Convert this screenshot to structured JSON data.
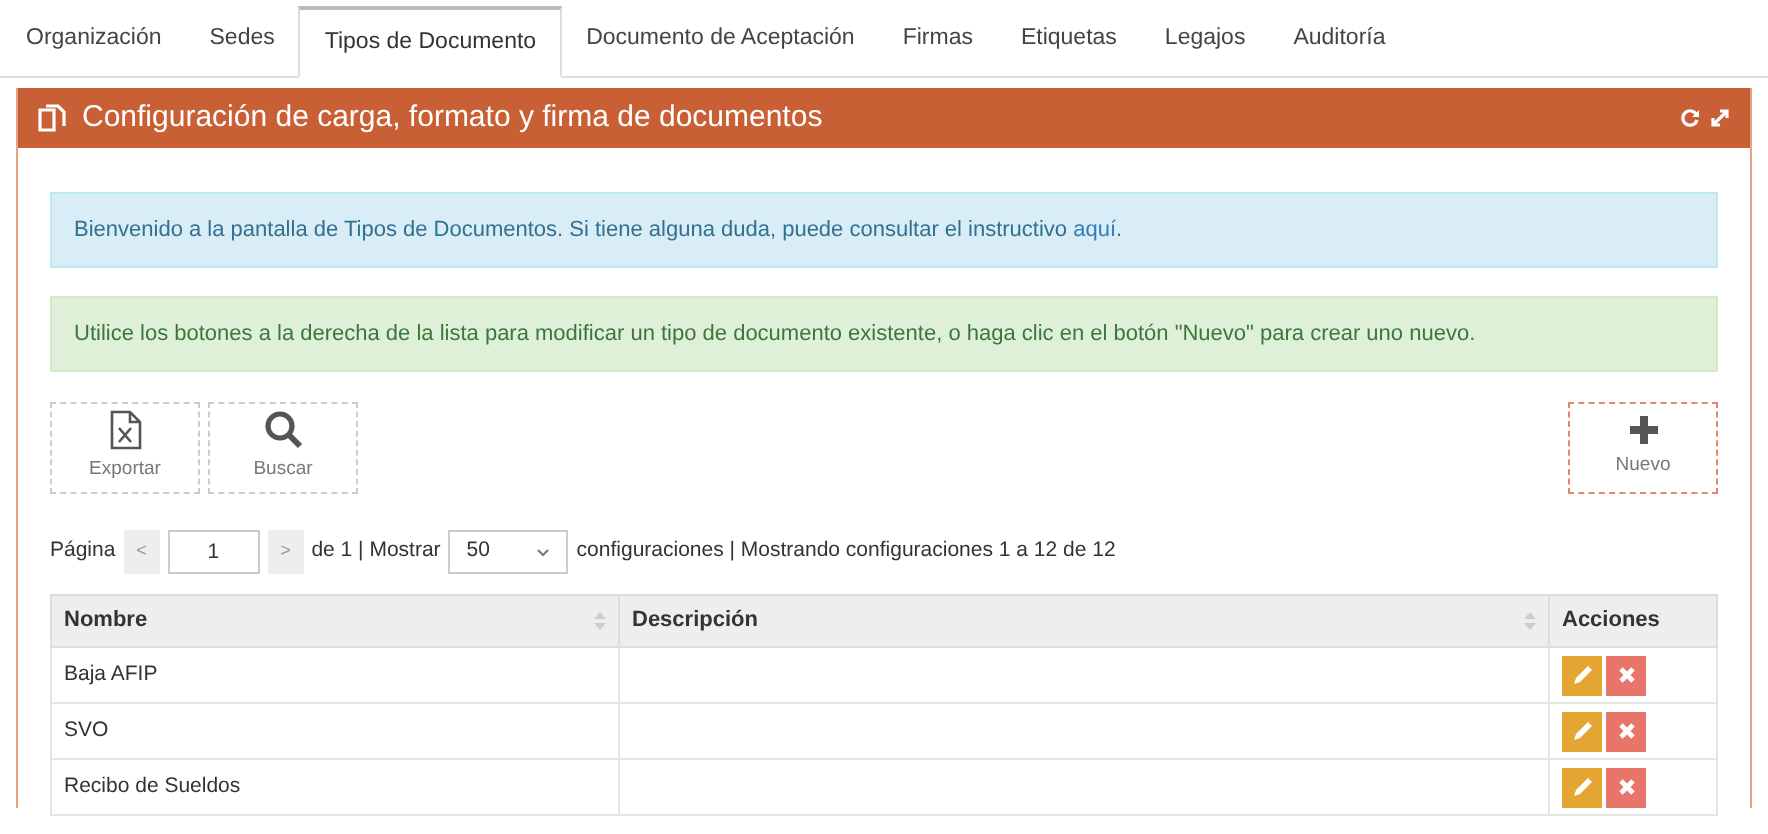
{
  "tabs": [
    {
      "label": "Organización",
      "selected": false
    },
    {
      "label": "Sedes",
      "selected": false
    },
    {
      "label": "Tipos de Documento",
      "selected": true
    },
    {
      "label": "Documento de Aceptación",
      "selected": false
    },
    {
      "label": "Firmas",
      "selected": false
    },
    {
      "label": "Etiquetas",
      "selected": false
    },
    {
      "label": "Legajos",
      "selected": false
    },
    {
      "label": "Auditoría",
      "selected": false
    }
  ],
  "panel": {
    "title": "Configuración de carga, formato y firma de documentos"
  },
  "info_alert": {
    "text": "Bienvenido a la pantalla de Tipos de Documentos. Si tiene alguna duda, puede consultar el instructivo ",
    "link": "aquí",
    "after": "."
  },
  "success_alert": {
    "text": "Utilice los botones a la derecha de la lista para modificar un tipo de documento existente, o haga clic en el botón \"Nuevo\" para crear uno nuevo."
  },
  "toolbar": [
    {
      "kind": "export",
      "label": "Exportar"
    },
    {
      "kind": "search",
      "label": "Buscar"
    },
    {
      "kind": "new",
      "label": "Nuevo"
    }
  ],
  "pagination": {
    "page_label": "Página",
    "prev": "<",
    "page": "1",
    "next": ">",
    "of": "de 1 | Mostrar",
    "page_size": "50",
    "summary": "configuraciones | Mostrando configuraciones 1 a 12 de 12"
  },
  "table": {
    "columns": [
      {
        "label": "Nombre",
        "sortable": true
      },
      {
        "label": "Descripción",
        "sortable": true
      },
      {
        "label": "Acciones",
        "sortable": false
      }
    ],
    "rows": [
      {
        "nombre": "Baja AFIP",
        "descripcion": ""
      },
      {
        "nombre": "SVO",
        "descripcion": ""
      },
      {
        "nombre": "Recibo de Sueldos",
        "descripcion": ""
      }
    ]
  }
}
